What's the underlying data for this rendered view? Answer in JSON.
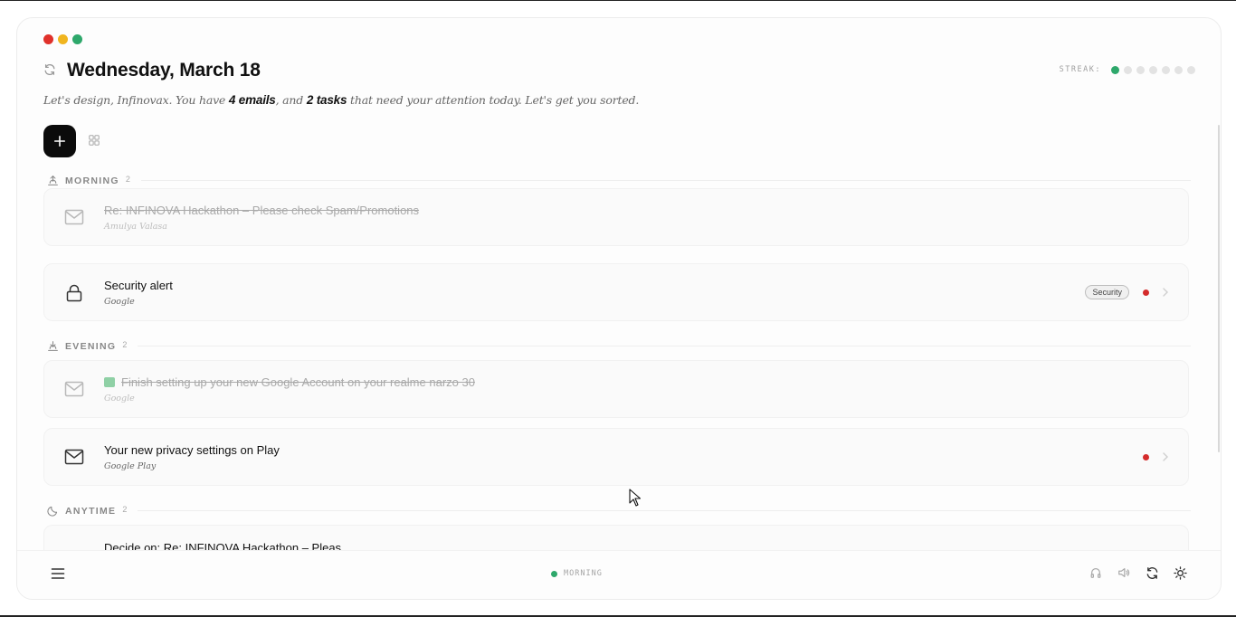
{
  "header": {
    "title": "Wednesday, March 18",
    "streak_label": "STREAK:",
    "streak": {
      "completed": 1,
      "total": 7
    }
  },
  "subtitle": {
    "part1": "Let's design, Infinovax. You have ",
    "emails": "4 emails",
    "part2": ", and ",
    "tasks": "2 tasks",
    "part3": " that need your attention today. Let's get you sorted."
  },
  "sections": {
    "morning": {
      "label": "MORNING",
      "count": "2",
      "items": [
        {
          "title": "Re: INFINOVA Hackathon – Please check Spam/Promotions",
          "sender": "Amulya Valasa",
          "done": true,
          "icon": "mail-icon"
        },
        {
          "title": "Security alert",
          "sender": "Google",
          "tag": "Security",
          "done": false,
          "icon": "lock-icon"
        }
      ]
    },
    "evening": {
      "label": "EVENING",
      "count": "2",
      "items": [
        {
          "title": "Finish setting up your new Google Account on your realme narzo 30",
          "sender": "Google",
          "done": true,
          "icon": "mail-icon"
        },
        {
          "title": "Your new privacy settings on Play",
          "sender": "Google Play",
          "done": false,
          "icon": "mail-icon"
        }
      ]
    },
    "anytime": {
      "label": "ANYTIME",
      "count": "2",
      "items": [
        {
          "title": "Decide on: Re: INFINOVA Hackathon – Pleas",
          "icon": "mail-icon"
        }
      ]
    }
  },
  "footer": {
    "period": "MORNING"
  },
  "colors": {
    "accent_green": "#2ea86b",
    "alert_red": "#d42b2b",
    "primary_dark": "#0b0b0b"
  }
}
